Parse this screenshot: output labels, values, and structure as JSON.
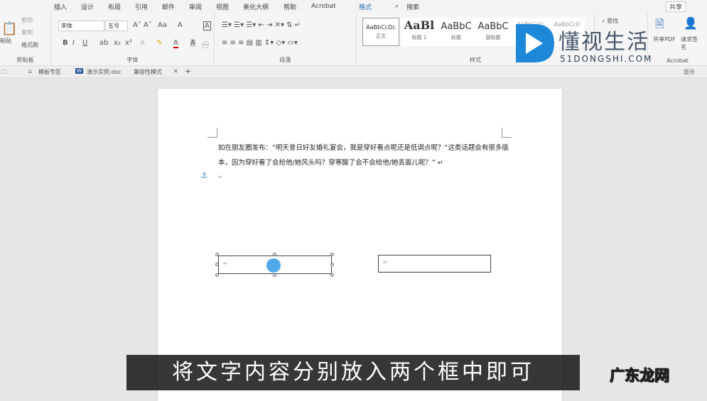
{
  "menu": {
    "tabs": [
      "插入",
      "设计",
      "布局",
      "引用",
      "邮件",
      "审阅",
      "视图",
      "美化大纲",
      "帮助",
      "Acrobat",
      "格式"
    ],
    "search": "搜索",
    "share": "共享"
  },
  "ribbon": {
    "clipboard": {
      "paste": "粘贴",
      "cut": "剪切",
      "copy": "复制",
      "format_painter": "格式刷",
      "label": "剪贴板"
    },
    "font": {
      "name": "宋体",
      "size": "五号",
      "label": "字体"
    },
    "paragraph": {
      "label": "段落"
    },
    "styles": {
      "items": [
        {
          "preview": "AaBbCcDc",
          "name": "正文"
        },
        {
          "preview": "AaBl",
          "name": "标题 1"
        },
        {
          "preview": "AaBbC",
          "name": "标题"
        },
        {
          "preview": "AaBbC",
          "name": "副标题"
        },
        {
          "preview": "AaBbCcD",
          "name": ""
        },
        {
          "preview": "AaBbCcD",
          "name": ""
        }
      ],
      "label": "样式"
    },
    "editing": {
      "find": "查找"
    },
    "acrobat": {
      "share_pdf": "共享PDF",
      "request_sign": "请求签名",
      "label": "Acrobat"
    }
  },
  "tabbar": {
    "template": "模板专区",
    "doc": "演示实例.doc",
    "mode": "兼容性模式",
    "display": "显示"
  },
  "document": {
    "paragraph1": "如在朋友圈发布：“明天昔日好友婚礼宴会，我是穿好看点呢还是低调点呢？“这类话题会有很多版本，因为穿好看了会抢他/她风头吗？穿寒酸了会不会给他/她丢面儿呢？” ↵",
    "empty_mark": "↵",
    "textbox_mark": "↵"
  },
  "subtitle": "将文字内容分别放入两个框中即可",
  "watermark": {
    "brand": "懂视生活",
    "url": "51DONGSHI.COM",
    "corner": "广东龙网"
  },
  "colors": {
    "accent": "#1e88d8",
    "subtitle_bg": "#141414"
  }
}
